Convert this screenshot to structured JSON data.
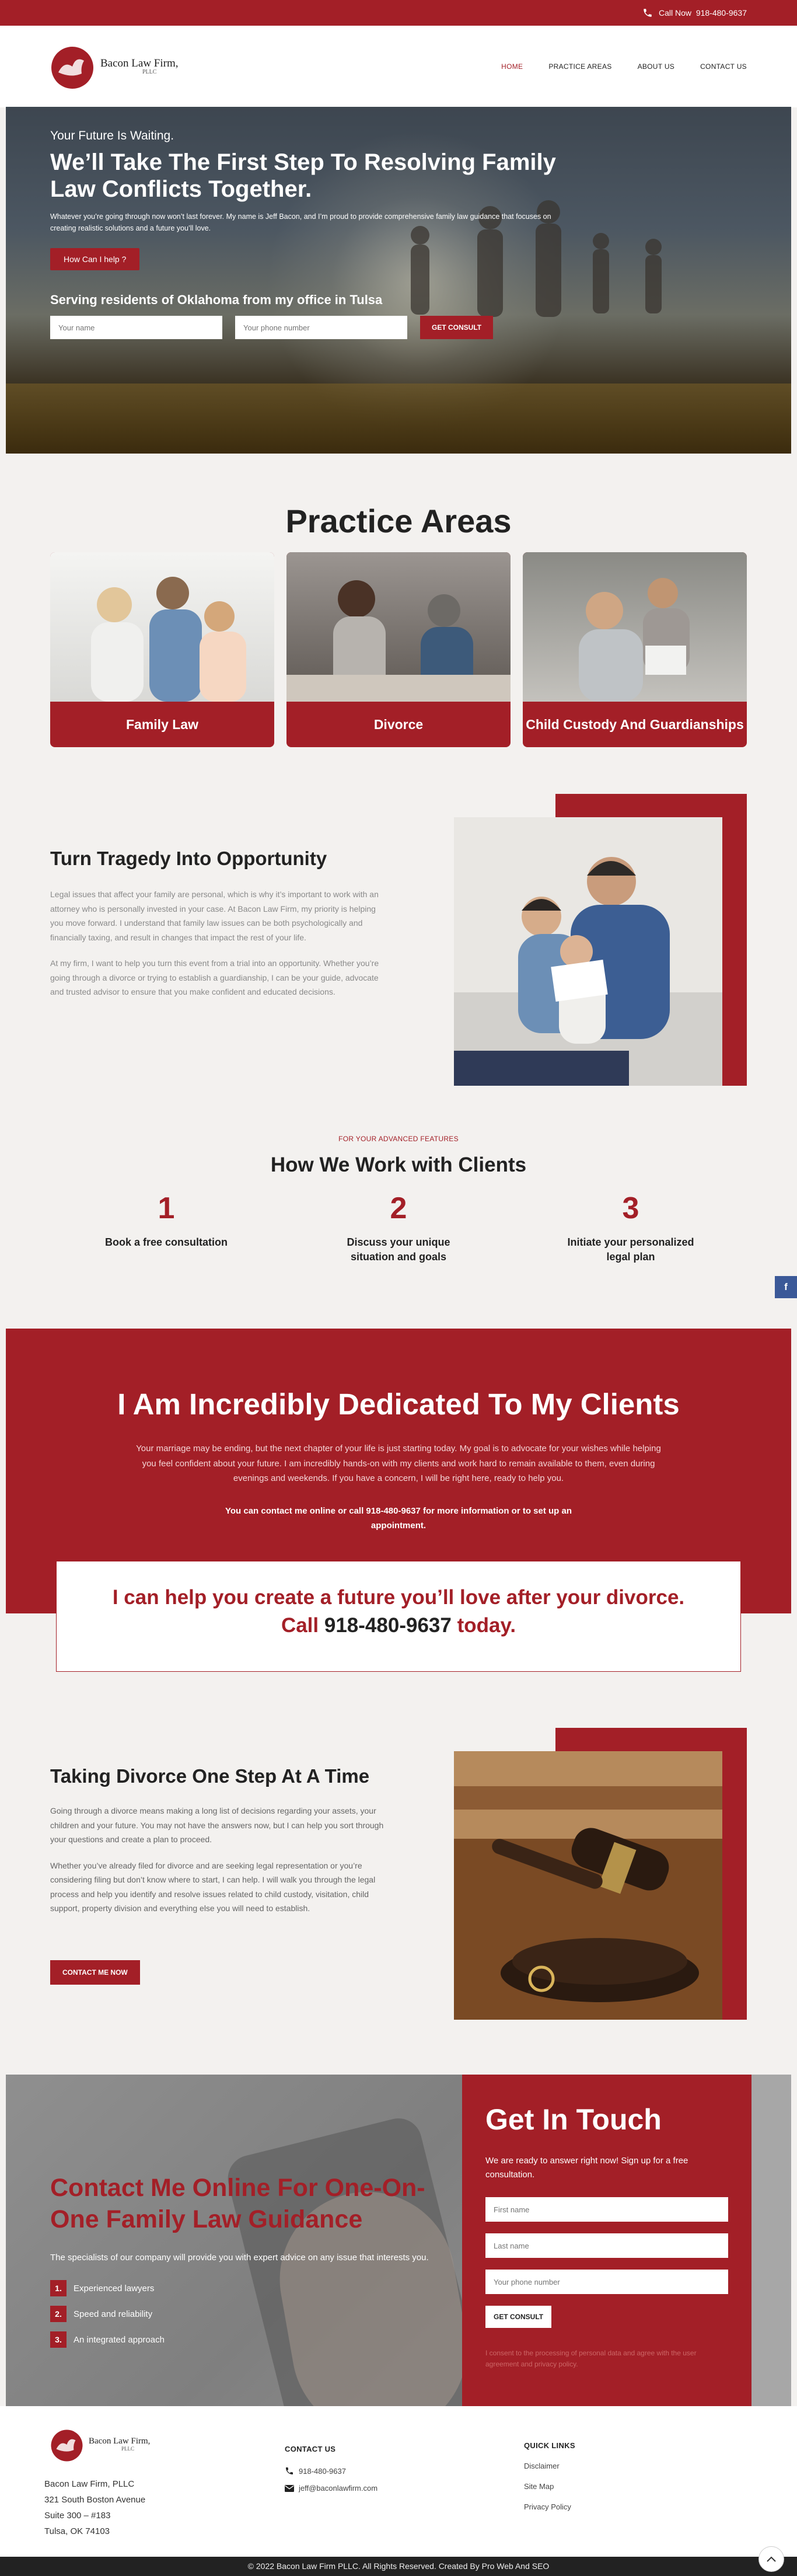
{
  "topbar": {
    "call_label": "Call Now",
    "phone": "918-480-9637"
  },
  "brand": {
    "name": "Bacon Law Firm,",
    "suffix": "PLLC"
  },
  "nav": {
    "items": [
      {
        "label": "HOME",
        "active": true
      },
      {
        "label": "PRACTICE AREAS",
        "active": false
      },
      {
        "label": "ABOUT US",
        "active": false
      },
      {
        "label": "CONTACT US",
        "active": false
      }
    ]
  },
  "hero": {
    "kicker": "Your Future Is Waiting.",
    "title": "We’ll Take The First Step To Resolving Family Law Conflicts Together.",
    "text": "Whatever you’re going through now won’t last forever. My name is Jeff Bacon, and I’m proud to provide comprehensive family law guidance that focuses on creating realistic solutions and a future you’ll love.",
    "button": "How Can I help ?",
    "subtitle": "Serving residents of Oklahoma from my office in Tulsa",
    "name_placeholder": "Your name",
    "phone_placeholder": "Your phone number",
    "submit": "GET CONSULT"
  },
  "practice": {
    "title": "Practice Areas",
    "cards": [
      {
        "label": "Family Law"
      },
      {
        "label": "Divorce"
      },
      {
        "label": "Child Custody And Guardianships"
      }
    ]
  },
  "tragedy": {
    "title": "Turn Tragedy Into Opportunity",
    "p1": "Legal issues that affect your family are personal, which is why it’s important to work with an attorney who is personally invested in your case. At Bacon Law Firm, my priority is helping you move forward. I understand that family law issues can be both psychologically and financially taxing, and result in changes that impact the rest of your life.",
    "p2": "At my firm, I want to help you turn this event from a trial into an opportunity. Whether you’re going through a divorce or trying to establish a guardianship, I can be your guide, advocate and trusted advisor to ensure that you make confident and educated decisions."
  },
  "how": {
    "kicker": "FOR YOUR ADVANCED FEATURES",
    "title": "How We Work with Clients",
    "steps": [
      {
        "num": "1",
        "label": "Book a free consultation"
      },
      {
        "num": "2",
        "label": "Discuss your unique situation and goals"
      },
      {
        "num": "3",
        "label": "Initiate your personalized legal plan"
      }
    ]
  },
  "social": {
    "facebook": "f"
  },
  "dedicated": {
    "title": "I Am Incredibly Dedicated To My Clients",
    "text": "Your marriage may be ending, but the next chapter of your life is just starting today. My goal is to advocate for your wishes while helping you feel confident about your future. I am incredibly hands-on with my clients and work hard to remain available to them, even during evenings and weekends. If you have a concern, I will be right here, ready to help you.",
    "contact": "You can contact me online or call 918-480-9637 for more information or to set up an appointment.",
    "box_line1": "I can help you create a future you’ll love after your divorce.",
    "box_call": "Call",
    "box_phone": "918-480-9637",
    "box_today": "today."
  },
  "divorce": {
    "title": "Taking Divorce One Step At A Time",
    "p1": "Going through a divorce means making a long list of decisions regarding your assets, your children and your future. You may not have the answers now, but I can help you sort through your questions and create a plan to proceed.",
    "p2": "Whether you’ve already filed for divorce and are seeking legal representation or you’re considering filing but don’t know where to start, I can help. I will walk you through the legal process and help you identify and resolve issues related to child custody, visitation, child support, property division and everything else you will need to establish.",
    "button": "CONTACT ME NOW"
  },
  "cta": {
    "title": "Contact Me Online For One-On-One Family Law Guidance",
    "text": "The specialists of our company will provide you with expert advice on any issue that interests you.",
    "list": [
      {
        "n": "1.",
        "label": "Experienced lawyers"
      },
      {
        "n": "2.",
        "label": "Speed and reliability"
      },
      {
        "n": "3.",
        "label": "An integrated approach"
      }
    ]
  },
  "get_in_touch": {
    "title": "Get In Touch",
    "text": "We are ready to answer right now! Sign up for a free consultation.",
    "first_placeholder": "First name",
    "last_placeholder": "Last name",
    "phone_placeholder": "Your phone number",
    "submit": "GET CONSULT",
    "consent": "I consent to the processing of personal data and agree with the user agreement and privacy policy."
  },
  "footer": {
    "address": [
      "Bacon Law Firm, PLLC",
      "321 South Boston Avenue",
      "Suite 300 – #183",
      "Tulsa, OK 74103"
    ],
    "contact_heading": "CONTACT US",
    "phone": "918-480-9637",
    "email": "jeff@baconlawfirm.com",
    "links_heading": "QUICK LINKS",
    "links": [
      "Disclaimer",
      "Site Map",
      "Privacy Policy"
    ],
    "copyright": "© 2022 Bacon Law Firm PLLC. All Rights Reserved. Created  By Pro Web And SEO"
  },
  "colors": {
    "brand_red": "#a31f27",
    "dark": "#222222",
    "page_bg": "#f3f1ef"
  }
}
